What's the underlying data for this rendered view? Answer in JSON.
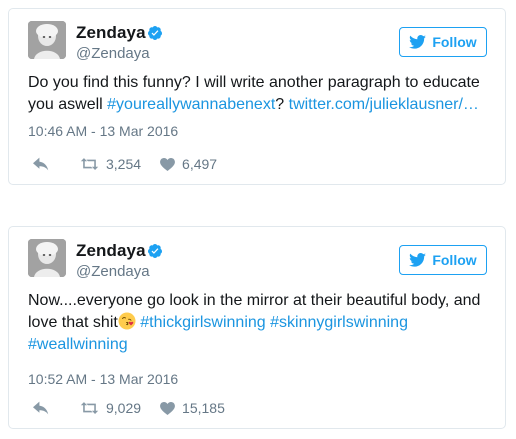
{
  "tweets": [
    {
      "display_name": "Zendaya",
      "handle": "@Zendaya",
      "follow_label": "Follow",
      "text_plain": "Do you find this funny? I will write another paragraph to educate you aswell ",
      "hashtag": "#youreallywannabenext",
      "text_between": "? ",
      "link": "twitter.com/julieklausner/…",
      "timestamp": "10:46 AM - 13 Mar 2016",
      "retweets": "3,254",
      "likes": "6,497"
    },
    {
      "display_name": "Zendaya",
      "handle": "@Zendaya",
      "follow_label": "Follow",
      "text_plain": "Now....everyone go look in the mirror at their beautiful body, and love that shit",
      "hashtags": [
        "#thickgirlswinning",
        "#skinnygirlswinning",
        "#weallwinning"
      ],
      "timestamp": "10:52 AM - 13 Mar 2016",
      "retweets": "9,029",
      "likes": "15,185"
    }
  ],
  "icons": {
    "verified": "verified-badge-icon",
    "follow": "bird-icon",
    "reply": "reply-icon",
    "retweet": "retweet-icon",
    "like": "heart-icon",
    "emoji": "kiss-face-emoji"
  },
  "colors": {
    "accent": "#1da1f2",
    "link": "#1b95e0",
    "muted": "#657786",
    "border": "#e1e8ed"
  }
}
